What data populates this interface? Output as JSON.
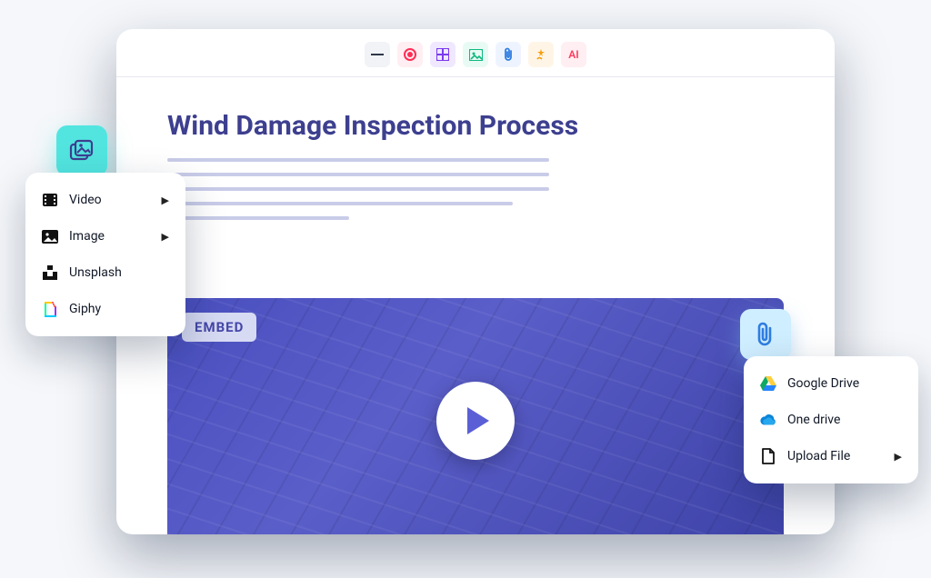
{
  "document": {
    "title": "Wind Damage Inspection Process"
  },
  "video": {
    "embed_label": "EMBED"
  },
  "toolbar": {
    "ai_label": "AI"
  },
  "media_menu": {
    "items": [
      {
        "label": "Video",
        "has_submenu": true
      },
      {
        "label": "Image",
        "has_submenu": true
      },
      {
        "label": "Unsplash",
        "has_submenu": false
      },
      {
        "label": "Giphy",
        "has_submenu": false
      }
    ]
  },
  "attach_menu": {
    "items": [
      {
        "label": "Google Drive",
        "has_submenu": false
      },
      {
        "label": "One drive",
        "has_submenu": false
      },
      {
        "label": "Upload File",
        "has_submenu": true
      }
    ]
  }
}
